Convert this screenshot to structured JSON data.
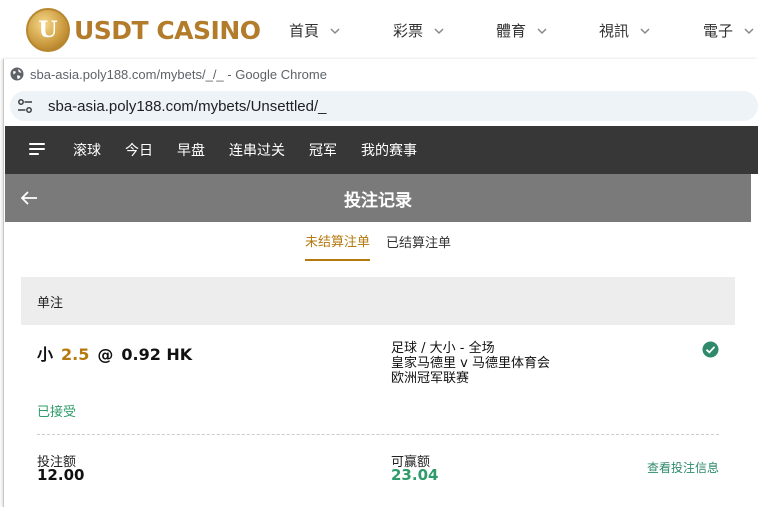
{
  "site": {
    "logo_letter": "U",
    "logo_text": "USDT CASINO",
    "nav": [
      {
        "label": "首頁"
      },
      {
        "label": "彩票"
      },
      {
        "label": "體育"
      },
      {
        "label": "視訊"
      },
      {
        "label": "電子"
      }
    ]
  },
  "browser": {
    "title": "sba-asia.poly188.com/mybets/_/_ - Google Chrome",
    "url": "sba-asia.poly188.com/mybets/Unsettled/_"
  },
  "app_nav": {
    "items": [
      {
        "label": "滚球"
      },
      {
        "label": "今日"
      },
      {
        "label": "早盘"
      },
      {
        "label": "连串过关"
      },
      {
        "label": "冠军"
      },
      {
        "label": "我的赛事"
      }
    ]
  },
  "page": {
    "title": "投注记录",
    "tabs": [
      {
        "label": "未结算注单",
        "active": true
      },
      {
        "label": "已结算注单",
        "active": false
      }
    ],
    "bet_type": "单注"
  },
  "bet": {
    "selection": "小",
    "line": "2.5",
    "at": "@",
    "odds": "0.92 HK",
    "market": "足球 / 大小 - 全场",
    "match": "皇家马德里 v 马德里体育会",
    "league": "欧洲冠军联赛",
    "status": "已接受",
    "stake_label": "投注额",
    "stake": "12.00",
    "win_label": "可赢额",
    "win": "23.04",
    "details_link": "查看投注信息"
  },
  "colors": {
    "accent_gold": "#b5790f",
    "success_green": "#2e9c6a",
    "nav_bg": "#373737",
    "header_bg": "#7a7a7a"
  },
  "icons": {
    "menu": "hamburger-menu-icon",
    "back": "arrow-left-icon",
    "accepted": "check-circle-icon",
    "site_info": "tune-icon",
    "chevron": "chevron-down-icon"
  }
}
